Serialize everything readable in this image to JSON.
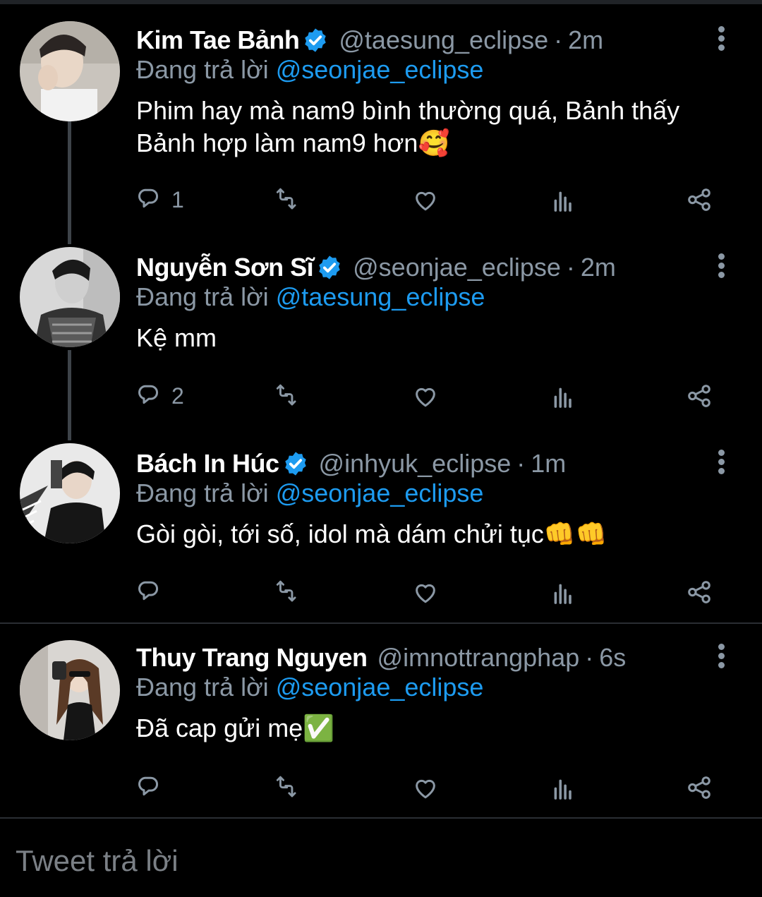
{
  "tweets": [
    {
      "name": "Kim Tae Bảnh",
      "handle": "@taesung_eclipse",
      "time": "2m",
      "replying_prefix": "Đang trả lời ",
      "replying_to": "@seonjae_eclipse",
      "text": "Phim hay mà nam9 bình thường quá, Bảnh thấy Bảnh hợp làm nam9 hơn🥰",
      "reply_count": "1"
    },
    {
      "name": "Nguyễn Sơn Sĩ",
      "handle": "@seonjae_eclipse",
      "time": "2m",
      "replying_prefix": "Đang trả lời ",
      "replying_to": "@taesung_eclipse",
      "text": "Kệ mm",
      "reply_count": "2"
    },
    {
      "name": "Bách In Húc",
      "handle": "@inhyuk_eclipse",
      "time": "1m",
      "replying_prefix": "Đang trả lời ",
      "replying_to": "@seonjae_eclipse",
      "text": "Gòi gòi, tới số, idol mà dám chửi tục👊👊",
      "reply_count": ""
    },
    {
      "name": "Thuy Trang Nguyen",
      "handle": "@imnottrangphap",
      "time": "6s",
      "replying_prefix": "Đang trả lời ",
      "replying_to": "@seonjae_eclipse",
      "text": "Đã cap gửi mẹ✅",
      "reply_count": ""
    }
  ],
  "separator": "·",
  "compose": {
    "placeholder": "Tweet trả lời"
  },
  "icons": [
    "reply-icon",
    "retweet-icon",
    "like-icon",
    "analytics-icon",
    "share-icon",
    "more-options-icon",
    "verified-badge-icon"
  ],
  "colors": {
    "background": "#000000",
    "accent": "#1d9bf0",
    "muted": "#8b98a5",
    "verified": "#1d9bf0"
  }
}
